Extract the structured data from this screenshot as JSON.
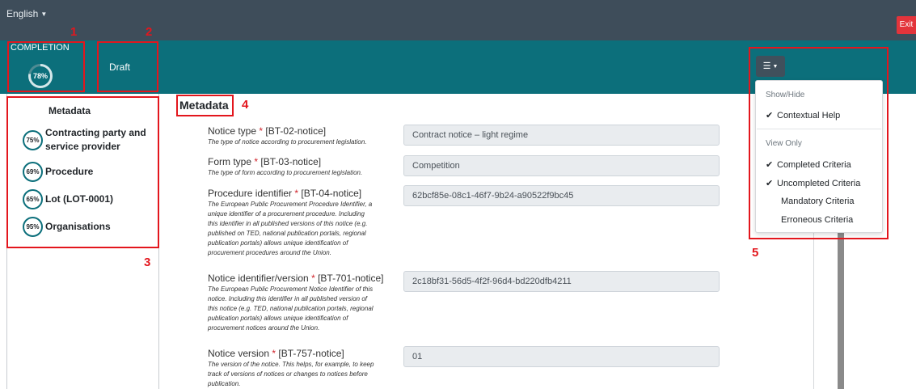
{
  "header": {
    "language": "English",
    "exit_label": "Exit"
  },
  "status": {
    "completion_label": "COMPLETION",
    "completion_percent": "78%",
    "draft_label": "Draft"
  },
  "annotations": {
    "n1": "1",
    "n2": "2",
    "n3": "3",
    "n4": "4",
    "n5": "5"
  },
  "sidebar": {
    "title": "Metadata",
    "items": [
      {
        "percent": "75%",
        "label_line1": "Contracting party and",
        "label_line2": "service provider"
      },
      {
        "percent": "69%",
        "label_line1": "Procedure",
        "label_line2": ""
      },
      {
        "percent": "65%",
        "label_line1": "Lot (LOT-0001)",
        "label_line2": ""
      },
      {
        "percent": "95%",
        "label_line1": "Organisations",
        "label_line2": ""
      }
    ]
  },
  "main": {
    "title": "Metadata",
    "fields": [
      {
        "label": "Notice type",
        "code": "[BT-02-notice]",
        "desc": [
          "The type of notice according to procurement legislation."
        ],
        "value": "Contract notice – light regime"
      },
      {
        "label": "Form type",
        "code": "[BT-03-notice]",
        "desc": [
          "The type of form according to procurement legislation."
        ],
        "value": "Competition"
      },
      {
        "label": "Procedure identifier",
        "code": "[BT-04-notice]",
        "desc": [
          "The European Public Procurement Procedure Identifier, a",
          "unique identifier of a procurement procedure. Including",
          "this identifier in all published versions of this notice (e.g.",
          "published on TED, national publication portals, regional",
          "publication portals) allows unique identification of",
          "procurement procedures around the Union."
        ],
        "value": "62bcf85e-08c1-46f7-9b24-a90522f9bc45"
      },
      {
        "label": "Notice identifier/version",
        "code": "[BT-701-notice]",
        "desc": [
          "The European Public Procurement Notice Identifier of this",
          "notice. Including this identifier in all published version of",
          "this notice (e.g. TED, national publication portals, regional",
          "publication portals) allows unique identification of",
          "procurement notices around the Union."
        ],
        "value": "2c18bf31-56d5-4f2f-96d4-bd220dfb4211"
      },
      {
        "label": "Notice version",
        "code": "[BT-757-notice]",
        "desc": [
          "The version of the notice. This helps, for example, to keep",
          "track of versions of notices or changes to notices before",
          "publication."
        ],
        "value": "01"
      }
    ]
  },
  "menu": {
    "show_hide_header": "Show/Hide",
    "contextual_help": "Contextual Help",
    "view_only_header": "View Only",
    "completed": "Completed Criteria",
    "uncompleted": "Uncompleted Criteria",
    "mandatory": "Mandatory Criteria",
    "erroneous": "Erroneous Criteria"
  },
  "colors": {
    "topbar": "#3e4d5a",
    "band": "#0c6f7b",
    "exit": "#e3343b",
    "annotation_red": "#e3161d",
    "input_bg": "#e9ecef"
  }
}
